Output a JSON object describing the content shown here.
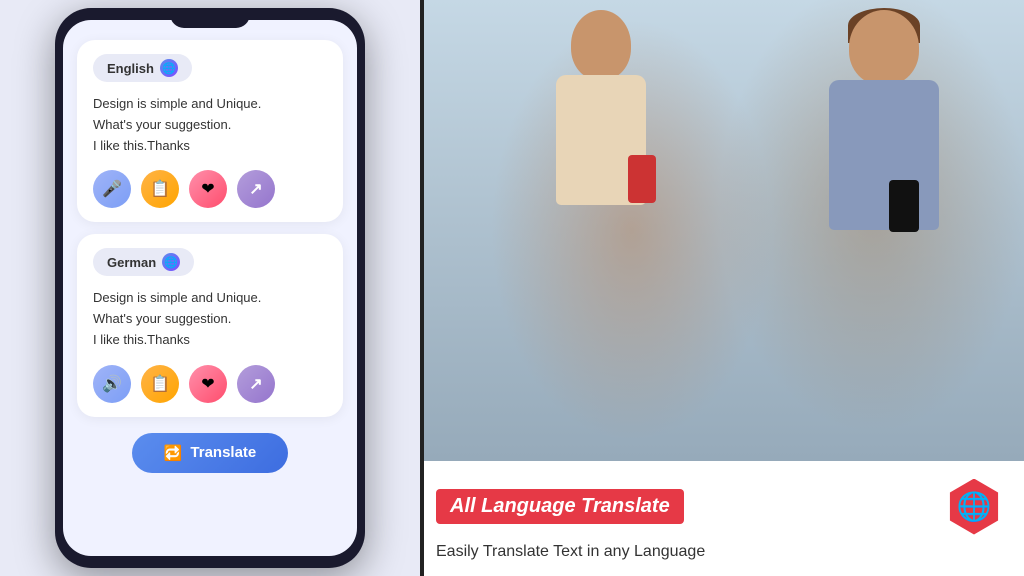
{
  "phone": {
    "card1": {
      "language": "English",
      "text_line1": "Design is simple and Unique.",
      "text_line2": "What's your suggestion.",
      "text_line3": "I like this.Thanks"
    },
    "card2": {
      "language": "German",
      "text_line1": "Design is simple and Unique.",
      "text_line2": "What's your suggestion.",
      "text_line3": "I like this.Thanks"
    },
    "translate_button": "Translate"
  },
  "banner": {
    "title": "All Language Translate",
    "subtitle": "Easily Translate Text in any  Language"
  },
  "icons": {
    "globe": "🌐",
    "mic": "🎤",
    "copy": "📋",
    "heart": "❤",
    "share": "⬆",
    "speaker": "🔊",
    "translate_icon": "🔁"
  },
  "colors": {
    "accent_blue": "#5b8dee",
    "accent_red": "#e63946",
    "card_bg": "#ffffff",
    "screen_bg": "#f0f2ff"
  }
}
